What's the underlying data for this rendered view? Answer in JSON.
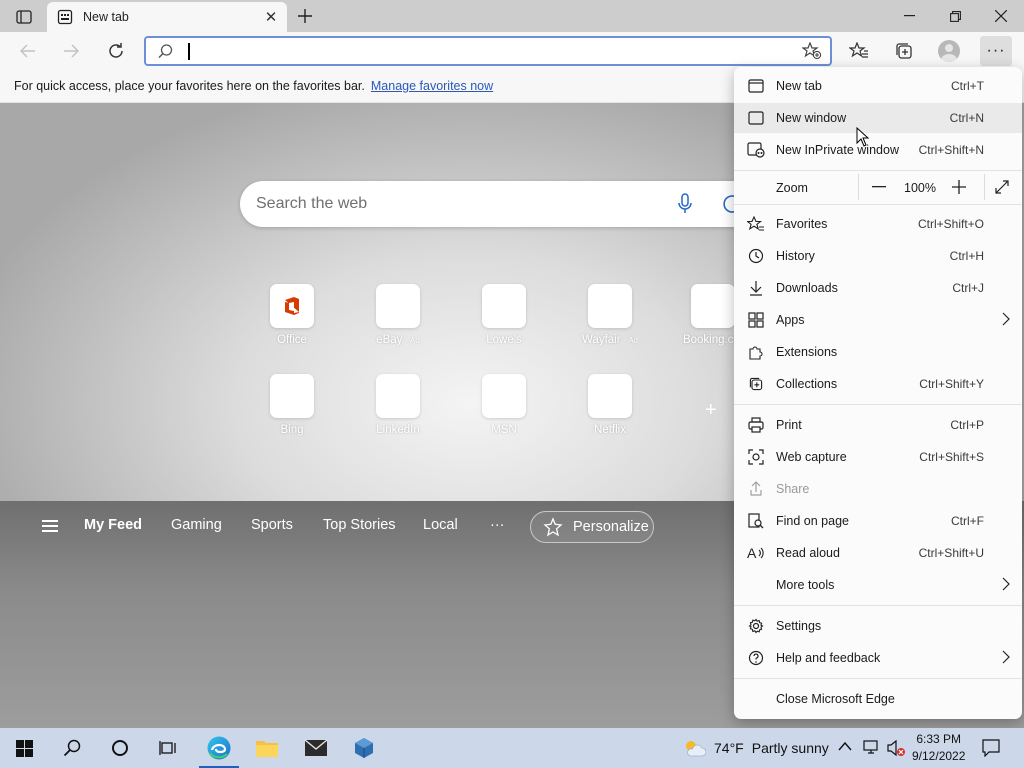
{
  "browser": {
    "tab": {
      "title": "New tab"
    },
    "address_bar": {
      "value": "",
      "placeholder": ""
    },
    "favorites_bar": {
      "message": "For quick access, place your favorites here on the favorites bar.",
      "link": "Manage favorites now"
    }
  },
  "ntp": {
    "search_placeholder": "Search the web",
    "tiles_row1": [
      {
        "label": "Office",
        "ad": ""
      },
      {
        "label": "eBay",
        "ad": "· Ad"
      },
      {
        "label": "Lowe's",
        "ad": ""
      },
      {
        "label": "Wayfair",
        "ad": "· Ad"
      },
      {
        "label": "Booking.c...",
        "ad": ""
      }
    ],
    "tiles_row2": [
      {
        "label": "Bing"
      },
      {
        "label": "LinkedIn"
      },
      {
        "label": "MSN"
      },
      {
        "label": "Netflix"
      }
    ],
    "feed_nav": [
      "My Feed",
      "Gaming",
      "Sports",
      "Top Stories",
      "Local",
      "···"
    ],
    "personalize": "Personalize"
  },
  "menu": {
    "items": [
      {
        "label": "New tab",
        "shortcut": "Ctrl+T"
      },
      {
        "label": "New window",
        "shortcut": "Ctrl+N"
      },
      {
        "label": "New InPrivate window",
        "shortcut": "Ctrl+Shift+N"
      },
      {
        "label": "Favorites",
        "shortcut": "Ctrl+Shift+O"
      },
      {
        "label": "History",
        "shortcut": "Ctrl+H"
      },
      {
        "label": "Downloads",
        "shortcut": "Ctrl+J"
      },
      {
        "label": "Apps",
        "shortcut": ""
      },
      {
        "label": "Extensions",
        "shortcut": ""
      },
      {
        "label": "Collections",
        "shortcut": "Ctrl+Shift+Y"
      },
      {
        "label": "Print",
        "shortcut": "Ctrl+P"
      },
      {
        "label": "Web capture",
        "shortcut": "Ctrl+Shift+S"
      },
      {
        "label": "Share",
        "shortcut": ""
      },
      {
        "label": "Find on page",
        "shortcut": "Ctrl+F"
      },
      {
        "label": "Read aloud",
        "shortcut": "Ctrl+Shift+U"
      },
      {
        "label": "More tools",
        "shortcut": ""
      },
      {
        "label": "Settings",
        "shortcut": ""
      },
      {
        "label": "Help and feedback",
        "shortcut": ""
      },
      {
        "label": "Close Microsoft Edge",
        "shortcut": ""
      }
    ],
    "zoom": {
      "label": "Zoom",
      "value": "100%"
    },
    "hovered_item": "New window",
    "disabled_item": "Share"
  },
  "taskbar": {
    "weather": {
      "temp": "74°F",
      "condition": "Partly sunny"
    },
    "clock": {
      "time": "6:33 PM",
      "date": "9/12/2022"
    }
  },
  "colors": {
    "accent": "#1e5fc0",
    "link": "#2c59b8",
    "address_focus": "#6b8fd8",
    "menu_hover": "#eaeaea"
  }
}
